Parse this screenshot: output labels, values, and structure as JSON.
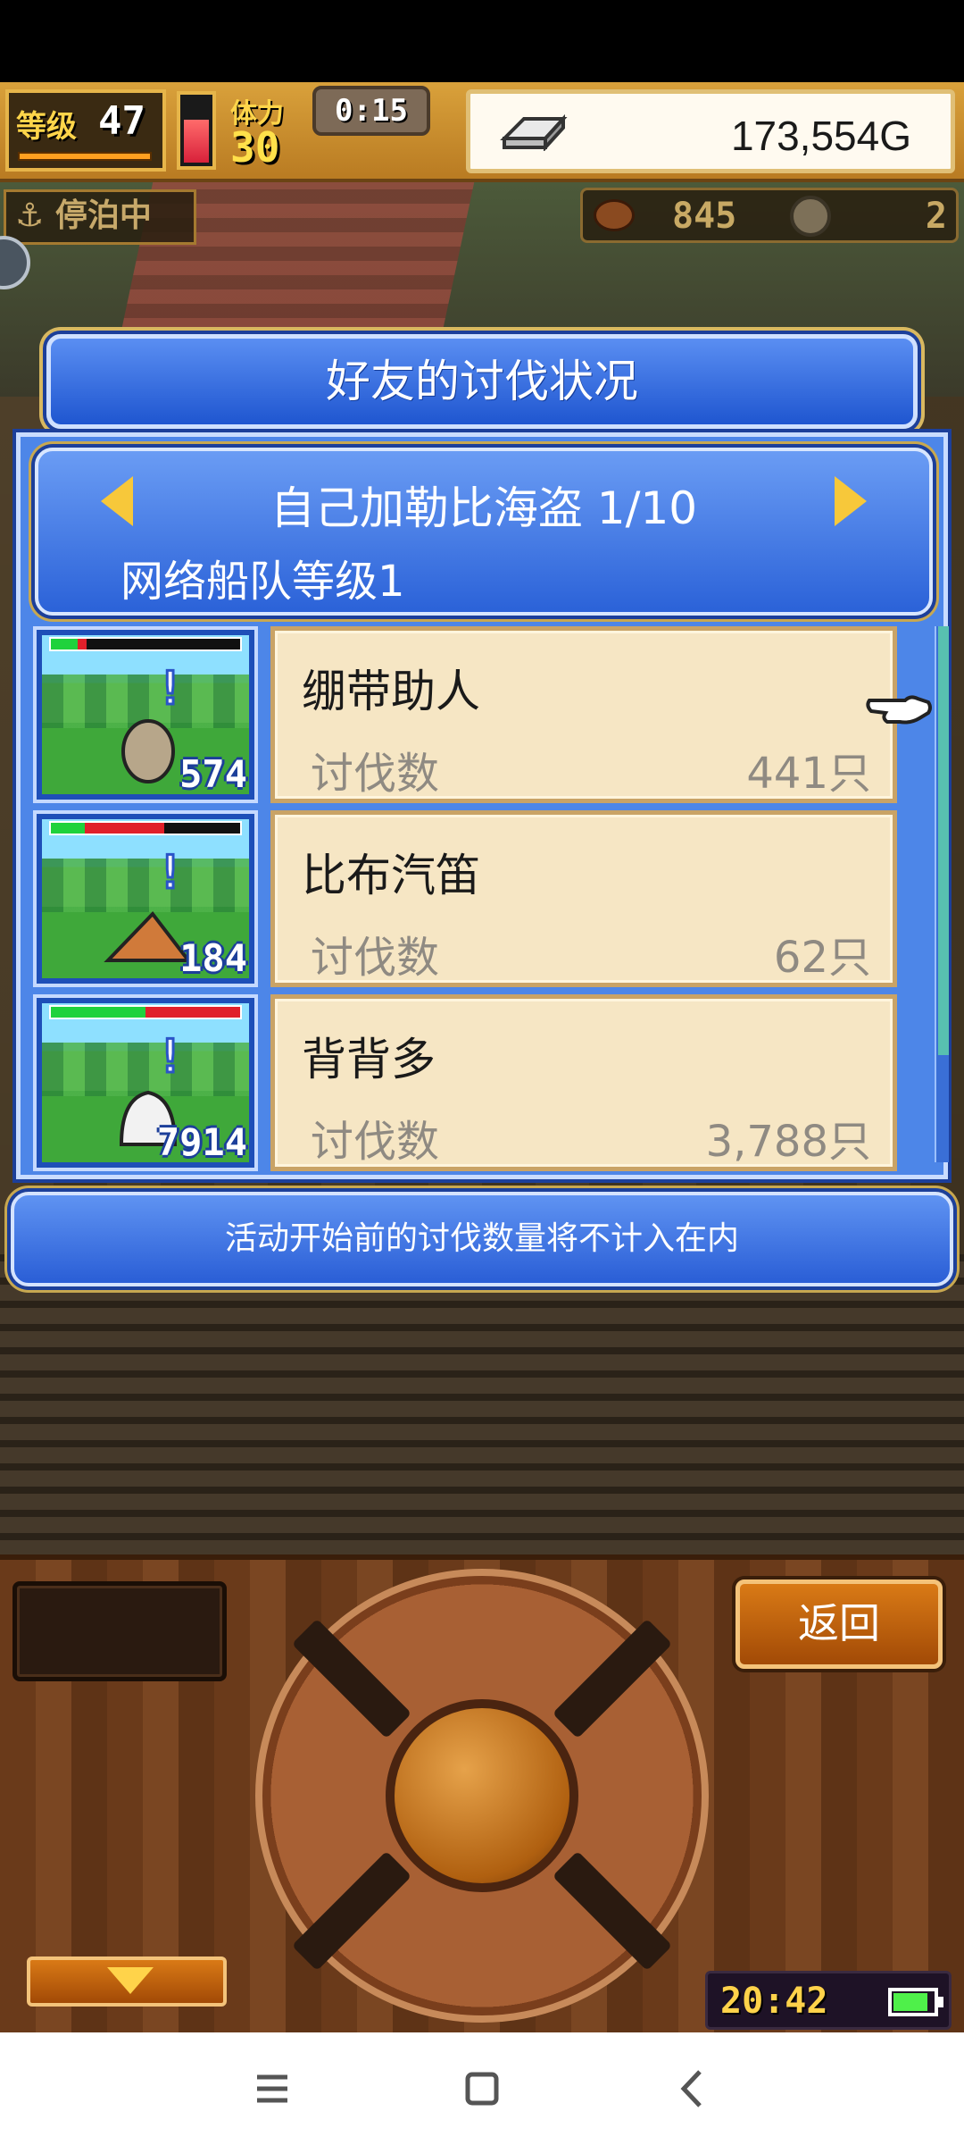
{
  "hud": {
    "level_label": "等级",
    "level_value": "47",
    "stamina_label": "体力",
    "stamina_value": "30",
    "timer": "0:15",
    "gold": "173,554G"
  },
  "scene": {
    "docked_label": "停泊中",
    "food_count": "845",
    "coin_count": "2"
  },
  "dialog": {
    "title": "好友的讨伐状况",
    "subtitle": "自己加勒比海盗 1/10",
    "fleet_level": "网络船队等级1",
    "entries": [
      {
        "name": "绷带助人",
        "kill_label": "讨伐数",
        "kill_value": "441只",
        "thumb_number": "574",
        "hp_green": 0.14,
        "hp_red": 0.05,
        "monster_color": "#b7a68a"
      },
      {
        "name": "比布汽笛",
        "kill_label": "讨伐数",
        "kill_value": "62只",
        "thumb_number": "184",
        "hp_green": 0.18,
        "hp_red": 0.42,
        "monster_color": "#d07a3a"
      },
      {
        "name": "背背多",
        "kill_label": "讨伐数",
        "kill_value": "3,788只",
        "thumb_number": "7914",
        "hp_green": 0.5,
        "hp_red": 0.5,
        "monster_color": "#f2f2f2"
      }
    ],
    "notice": "活动开始前的讨伐数量将不计入在内"
  },
  "controls": {
    "back_label": "返回",
    "clock": "20:42"
  },
  "colors": {
    "dialog_blue": "#2b62d8",
    "card_bg": "#f6e6c4",
    "button_orange": "#d97a16"
  }
}
